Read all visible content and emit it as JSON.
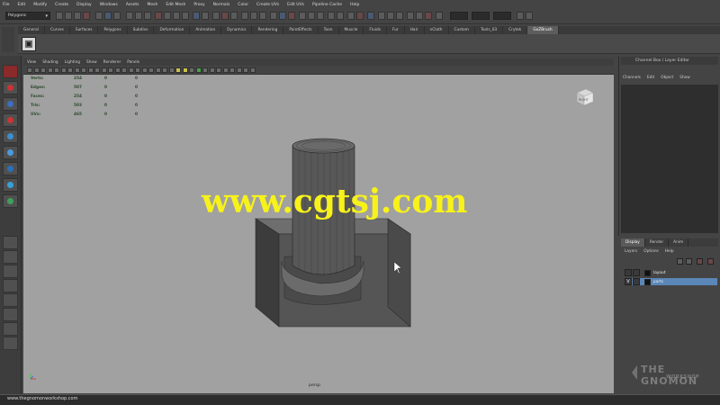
{
  "menubar": {
    "items": [
      "File",
      "Edit",
      "Modify",
      "Create",
      "Display",
      "Windows",
      "Assets",
      "Mesh",
      "Edit Mesh",
      "Proxy",
      "Normals",
      "Color",
      "Create UVs",
      "Edit UVs",
      "Pipeline Cache",
      "Help"
    ]
  },
  "statusline": {
    "mode": "Polygons"
  },
  "shelf": {
    "tabs": [
      "General",
      "Curves",
      "Surfaces",
      "Polygons",
      "Subdivs",
      "Deformation",
      "Animation",
      "Dynamics",
      "Rendering",
      "PaintEffects",
      "Toon",
      "Muscle",
      "Fluids",
      "Fur",
      "Hair",
      "nCloth",
      "Custom",
      "Tools_03",
      "Crytek",
      "GoZBrush"
    ],
    "active_tab": "GoZBrush"
  },
  "viewport": {
    "menu": [
      "View",
      "Shading",
      "Lighting",
      "Show",
      "Renderer",
      "Panels"
    ],
    "hud": [
      {
        "label": "Verts:",
        "a": "254",
        "b": "0",
        "c": "0"
      },
      {
        "label": "Edges:",
        "a": "507",
        "b": "0",
        "c": "0"
      },
      {
        "label": "Faces:",
        "a": "254",
        "b": "0",
        "c": "0"
      },
      {
        "label": "Tris:",
        "a": "503",
        "b": "0",
        "c": "0"
      },
      {
        "label": "UVs:",
        "a": "465",
        "b": "0",
        "c": "0"
      }
    ],
    "camera_label": "persp",
    "viewcube_label": "RIGHT",
    "watermark": "www.cgtsj.com"
  },
  "channel_box": {
    "title": "Channel Box / Layer Editor",
    "menu": [
      "Channels",
      "Edit",
      "Object",
      "Show"
    ]
  },
  "layer_editor": {
    "tabs": [
      "Display",
      "Render",
      "Anim"
    ],
    "active_tab": "Display",
    "menu": [
      "Layers",
      "Options",
      "Help"
    ],
    "layers": [
      {
        "name": "layout",
        "visible": "",
        "selected": false
      },
      {
        "name": "parts",
        "visible": "V",
        "selected": true
      }
    ]
  },
  "branding": {
    "logo": "THE GNOMON",
    "logo_sub": "WORKSHOP"
  },
  "helpline": {
    "text": "www.thegnomonworkshop.com"
  },
  "colors": {
    "viewport_bg": "#a1a1a1",
    "watermark": "#f7f21a",
    "selection": "#5b87b8",
    "active_tool": "#8a2a2a"
  }
}
